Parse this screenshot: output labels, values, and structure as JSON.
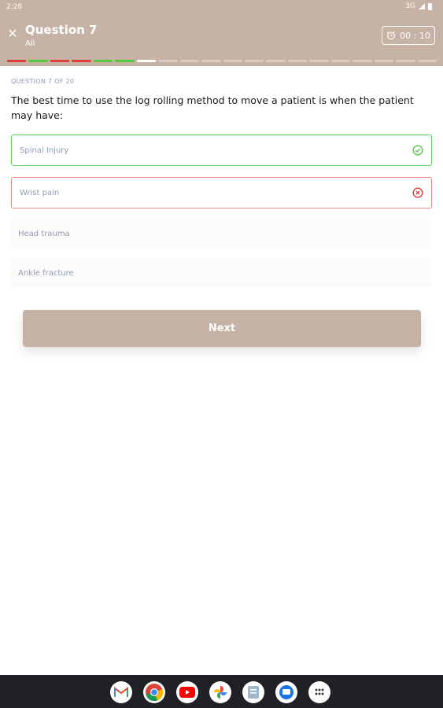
{
  "status": {
    "time": "2:28",
    "network": "3G"
  },
  "header": {
    "title": "Question 7",
    "subtitle": "All",
    "timer": "00 : 10"
  },
  "progress": [
    "wrong",
    "correct",
    "wrong",
    "wrong",
    "correct",
    "correct",
    "current",
    "pending",
    "pending",
    "pending",
    "pending",
    "pending",
    "pending",
    "pending",
    "pending",
    "pending",
    "pending",
    "pending",
    "pending",
    "pending"
  ],
  "colors": {
    "correct": "#55c840",
    "wrong": "#e0403a",
    "current": "#ffffff",
    "pending": "#d8ccc3",
    "accent": "#c7b3a5"
  },
  "question": {
    "counter": "QUESTION 7 OF 20",
    "text": "The best time to use the log rolling method to move a patient is when the patient may have:"
  },
  "options": [
    {
      "label": "Spinal Injury",
      "state": "correct"
    },
    {
      "label": "Wrist pain",
      "state": "wrong"
    },
    {
      "label": "Head trauma",
      "state": "none"
    },
    {
      "label": "Ankle fracture",
      "state": "none"
    }
  ],
  "next_label": "Next",
  "dock_apps": [
    "gmail-icon",
    "chrome-icon",
    "youtube-icon",
    "photos-icon",
    "files-icon",
    "messages-icon",
    "app-drawer-icon"
  ]
}
